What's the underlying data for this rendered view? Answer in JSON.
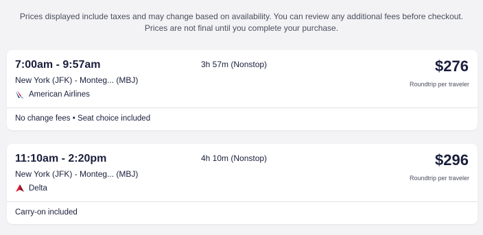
{
  "notice": {
    "line1": "Prices displayed include taxes and may change based on availability. You can review any additional fees before checkout.",
    "line2": "Prices are not final until you complete your purchase."
  },
  "flights": [
    {
      "times": "7:00am - 9:57am",
      "route": "New York (JFK) - Monteg... (MBJ)",
      "airline": "American Airlines",
      "airline_icon": "american-airlines-logo-icon",
      "duration": "3h 57m (Nonstop)",
      "price": "$276",
      "price_note": "Roundtrip per traveler",
      "features": "No change fees • Seat choice included"
    },
    {
      "times": "11:10am - 2:20pm",
      "route": "New York (JFK) - Monteg... (MBJ)",
      "airline": "Delta",
      "airline_icon": "delta-logo-icon",
      "duration": "4h 10m (Nonstop)",
      "price": "$296",
      "price_note": "Roundtrip per traveler",
      "features": "Carry-on included"
    }
  ],
  "colors": {
    "background": "#f3f3f5",
    "card": "#ffffff",
    "text": "#191e3b",
    "aa_blue": "#0b3f8f",
    "aa_red": "#c8102e",
    "delta_red": "#c8102e"
  }
}
